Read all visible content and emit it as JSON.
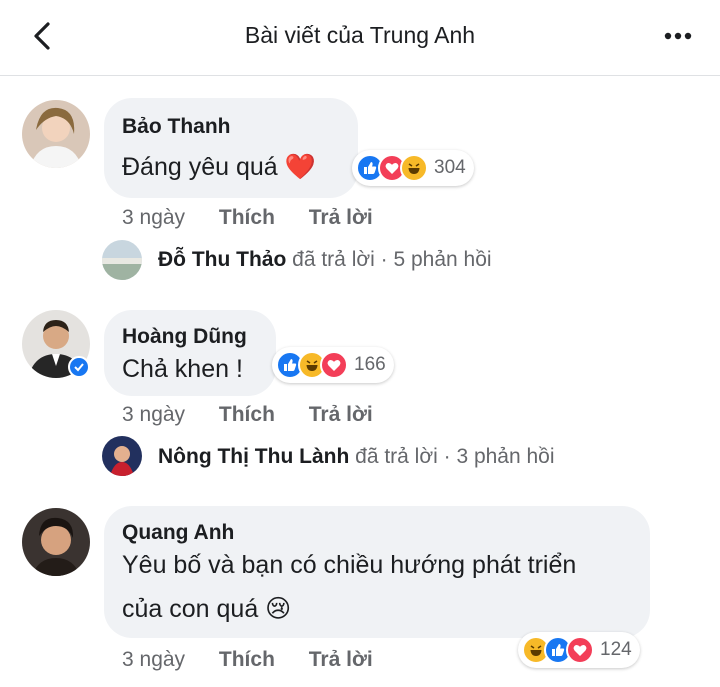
{
  "header": {
    "title": "Bài viết của Trung Anh"
  },
  "comments": [
    {
      "author": "Bảo Thanh",
      "text": "Đáng yêu quá ❤️",
      "reaction_count": "304",
      "reactions": [
        "like",
        "love",
        "haha"
      ],
      "time": "3 ngày",
      "like_label": "Thích",
      "reply_label": "Trả lời",
      "reply_summary": {
        "author": "Đỗ Thu Thảo",
        "text": "đã trả lời · 5 phản hồi"
      }
    },
    {
      "author": "Hoàng Dũng",
      "text": "Chả khen !",
      "reaction_count": "166",
      "reactions": [
        "like",
        "haha",
        "love"
      ],
      "time": "3 ngày",
      "like_label": "Thích",
      "reply_label": "Trả lời",
      "reply_summary": {
        "author": "Nông Thị Thu Lành",
        "text": "đã trả lời · 3 phản hồi"
      }
    },
    {
      "author": "Quang Anh",
      "text_line1": "Yêu bố và bạn có chiều hướng phát triển",
      "text_line2": "của con quá 😢",
      "reaction_count": "124",
      "reactions": [
        "haha",
        "like",
        "love"
      ],
      "time": "3 ngày",
      "like_label": "Thích",
      "reply_label": "Trả lời"
    }
  ],
  "colors": {
    "accent": "#1877f2",
    "love": "#f33e58",
    "haha": "#f7b928",
    "bubble": "#f0f2f5",
    "meta_text": "#65676b"
  }
}
